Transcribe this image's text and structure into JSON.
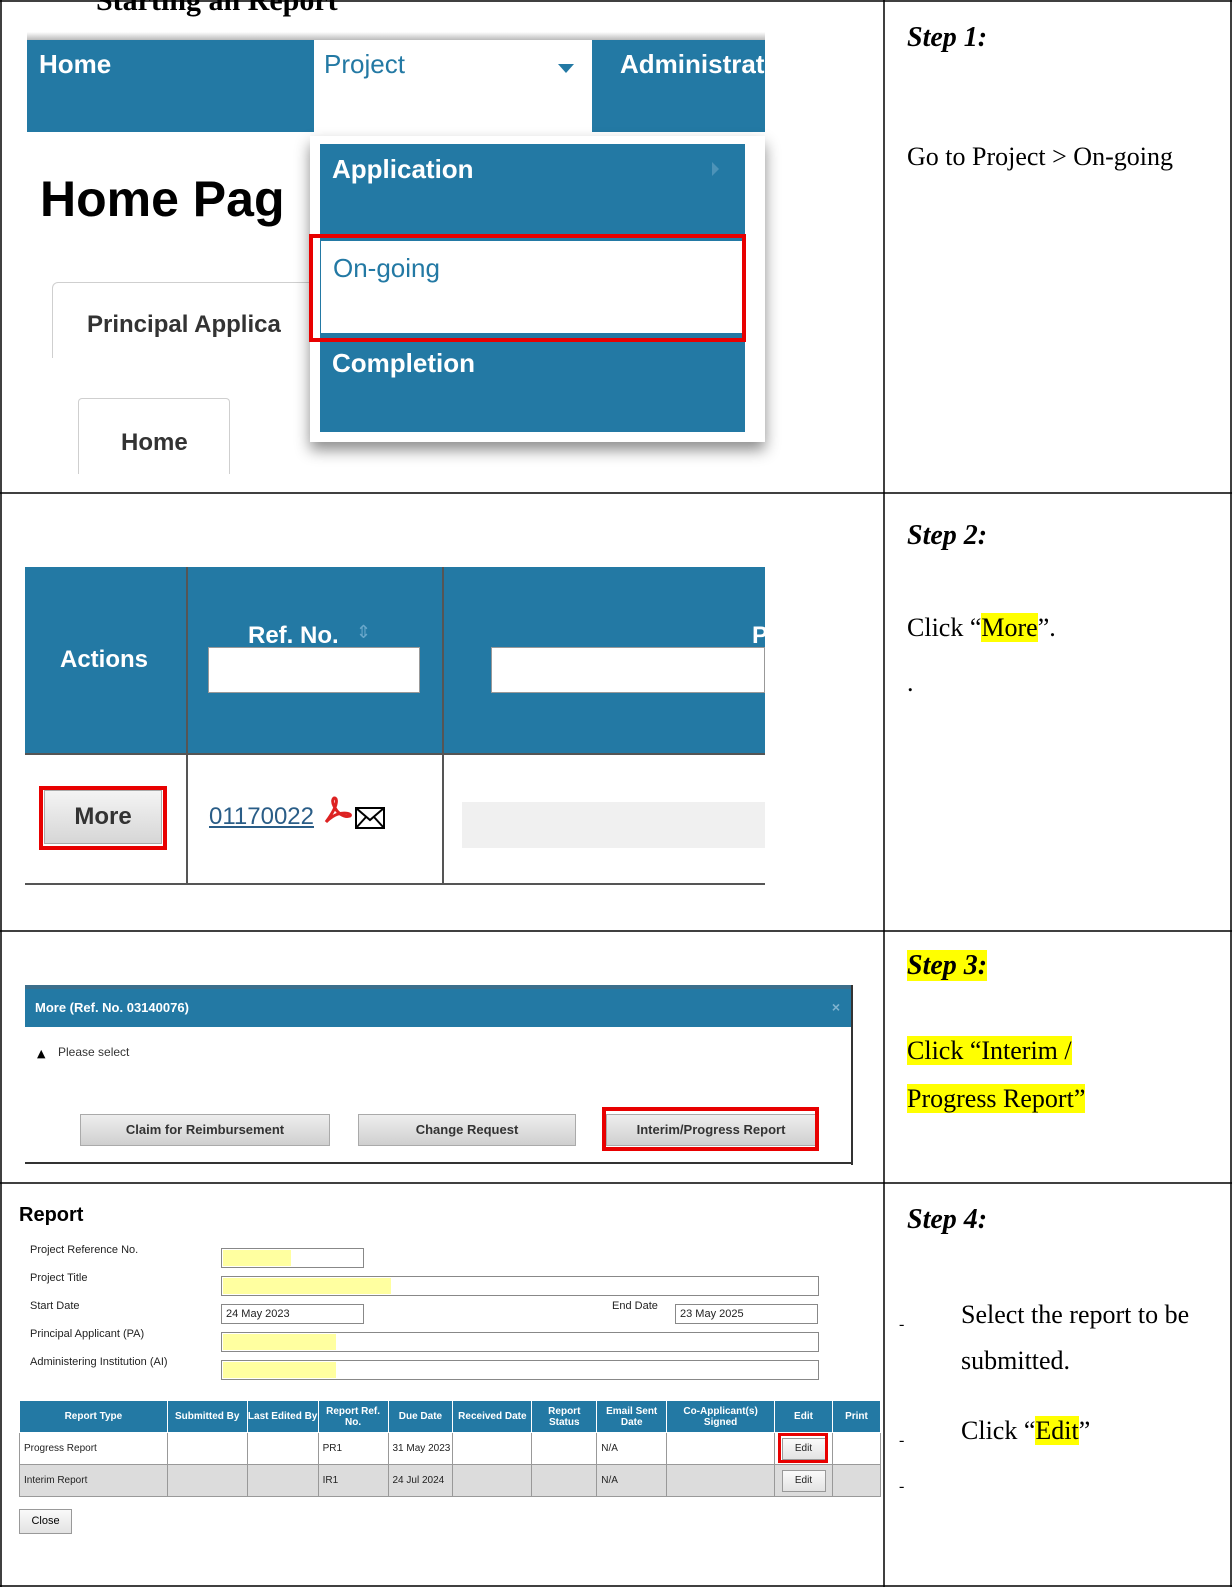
{
  "doc_title": "Starting an Report",
  "panel1": {
    "nav": {
      "home": "Home",
      "project": "Project",
      "administration": "Administrat"
    },
    "page_heading": "Home Pag",
    "tab_pa": "Principal Applica",
    "tab_home": "Home",
    "menu": {
      "application": "Application",
      "ongoing": "On-going",
      "completion": "Completion"
    }
  },
  "panel2": {
    "col_actions": "Actions",
    "col_ref": "Ref. No.",
    "col_p": "P",
    "more_button": "More",
    "ref_value": "01170022"
  },
  "panel3": {
    "dialog_title": "More (Ref. No. 03140076)",
    "close": "×",
    "message": "Please select",
    "btn_claim": "Claim for Reimbursement",
    "btn_change": "Change Request",
    "btn_interim": "Interim/Progress Report"
  },
  "panel4": {
    "heading": "Report",
    "labels": {
      "ref": "Project Reference No.",
      "title": "Project Title",
      "start": "Start Date",
      "end": "End Date",
      "pa": "Principal Applicant (PA)",
      "ai": "Administering Institution (AI)"
    },
    "start_date": "24 May 2023",
    "end_date": "23 May 2025",
    "table": {
      "headers": [
        "Report Type",
        "Submitted By",
        "Last Edited By",
        "Report Ref. No.",
        "Due Date",
        "Received Date",
        "Report Status",
        "Email Sent Date",
        "Co-Applicant(s) Signed",
        "Edit",
        "Print"
      ],
      "rows": [
        {
          "type": "Progress Report",
          "ref": "PR1",
          "due": "31 May 2023",
          "email": "N/A",
          "edit": "Edit"
        },
        {
          "type": "Interim Report",
          "ref": "IR1",
          "due": "24 Jul 2024",
          "email": "N/A",
          "edit": "Edit"
        }
      ]
    },
    "close_button": "Close"
  },
  "steps": {
    "s1": {
      "title": "Step 1:",
      "text": "Go to Project > On-going"
    },
    "s2": {
      "title": "Step 2:",
      "pre": "Click “",
      "hl": "More",
      "post": "”.",
      "dot": "."
    },
    "s3": {
      "title": "Step 3:",
      "line1": "Click “Interim /",
      "line2": "Progress Report”"
    },
    "s4": {
      "title": "Step 4:",
      "b1": "Select the report to be submitted.",
      "b2_pre": "Click “",
      "b2_hl": "Edit",
      "b2_post": "”"
    }
  }
}
